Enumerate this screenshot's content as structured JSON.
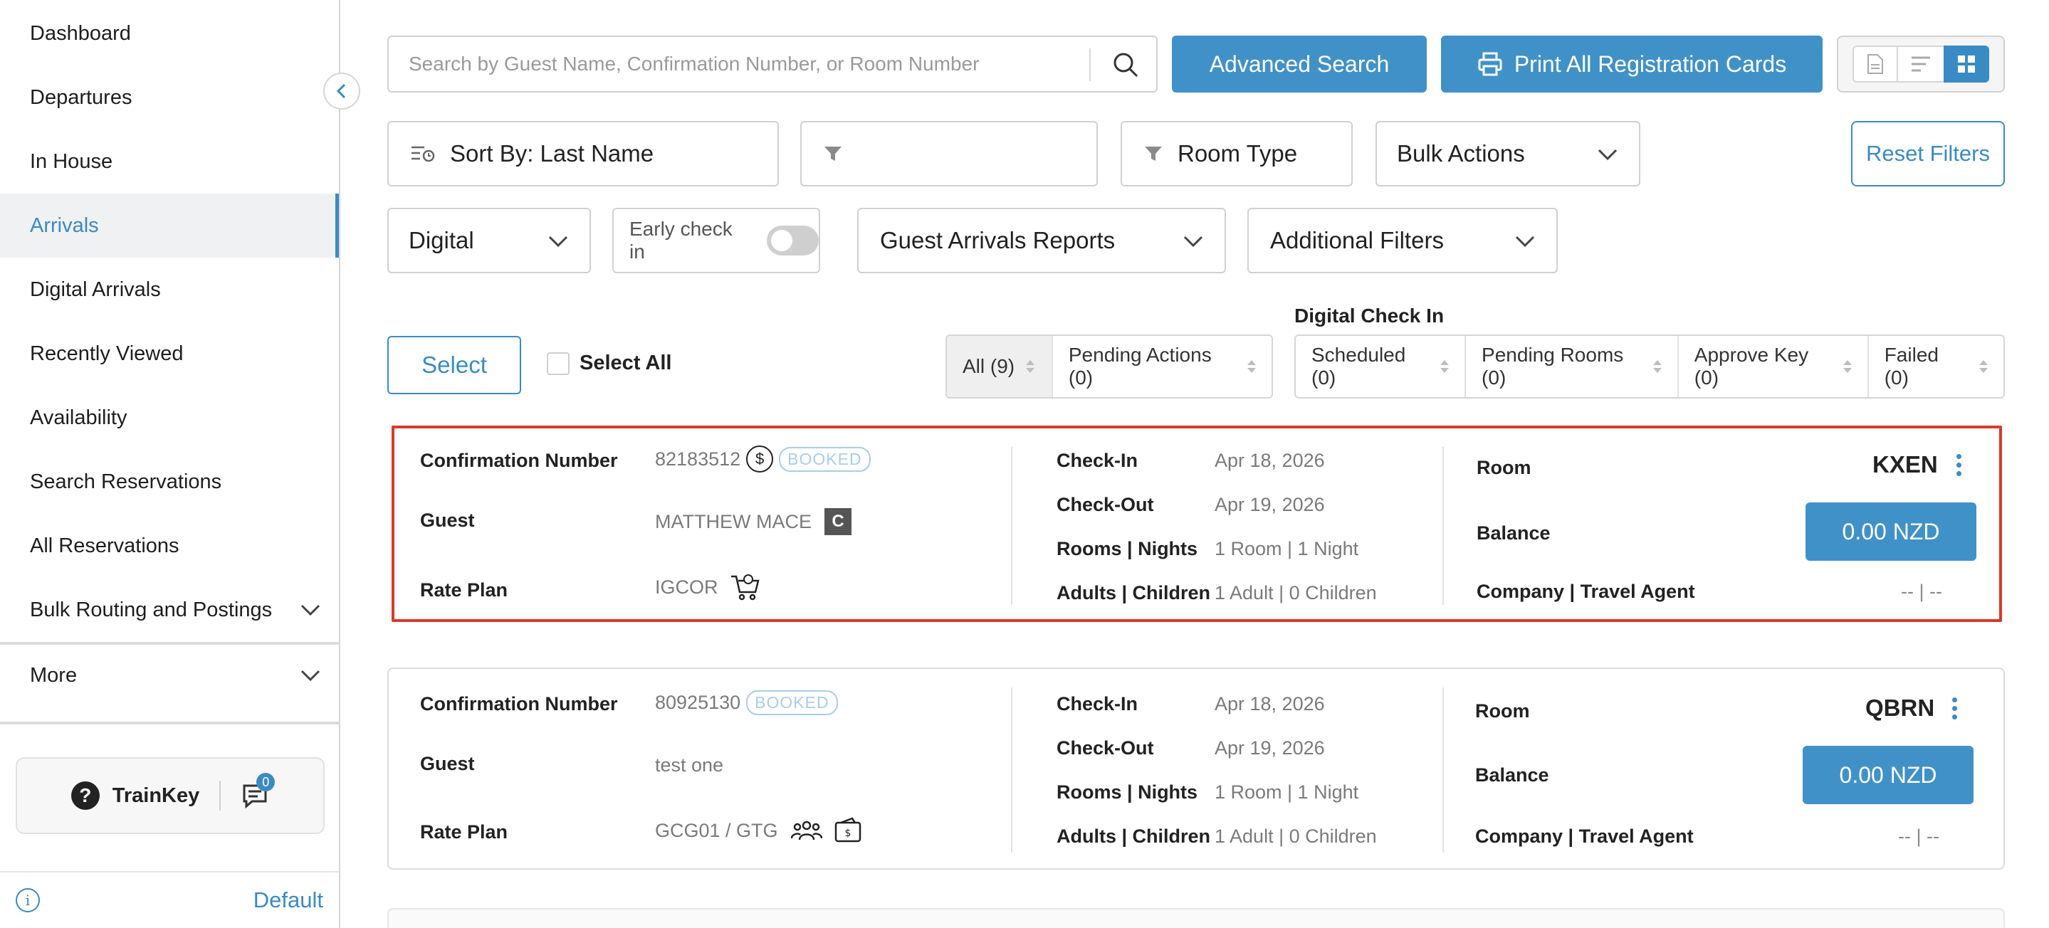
{
  "sidebar": {
    "items": [
      {
        "label": "Dashboard"
      },
      {
        "label": "Departures"
      },
      {
        "label": "In House"
      },
      {
        "label": "Arrivals"
      },
      {
        "label": "Digital Arrivals"
      },
      {
        "label": "Recently Viewed"
      },
      {
        "label": "Availability"
      },
      {
        "label": "Search Reservations"
      },
      {
        "label": "All Reservations"
      },
      {
        "label": "Bulk Routing and Postings"
      },
      {
        "label": "More"
      }
    ],
    "active_item": "Arrivals",
    "trainkey_label": "TrainKey",
    "chat_count": "0",
    "footer_label": "Default"
  },
  "toolbar": {
    "search_placeholder": "Search by Guest Name, Confirmation Number, or Room Number",
    "advanced_search": "Advanced Search",
    "print_cards": "Print All Registration Cards",
    "view_mode_selected": "grid"
  },
  "filters": {
    "sort_by": "Sort By: Last Name",
    "filter_empty": "",
    "room_type": "Room Type",
    "bulk_actions": "Bulk Actions",
    "reset_filters": "Reset Filters",
    "digital": "Digital",
    "early_checkin": "Early check in",
    "early_checkin_on": false,
    "reports": "Guest Arrivals Reports",
    "additional": "Additional Filters"
  },
  "status": {
    "select": "Select",
    "select_all": "Select All",
    "digital_checkin_title": "Digital Check In",
    "tabs": [
      "All (9)",
      "Pending Actions (0)"
    ],
    "digital_tabs": [
      "Scheduled (0)",
      "Pending Rooms (0)",
      "Approve Key (0)",
      "Failed (0)"
    ]
  },
  "labels": {
    "confirmation": "Confirmation Number",
    "guest": "Guest",
    "rate_plan": "Rate Plan",
    "check_in": "Check-In",
    "check_out": "Check-Out",
    "rooms_nights": "Rooms | Nights",
    "adults_children": "Adults | Children",
    "room": "Room",
    "balance": "Balance",
    "company_ta": "Company | Travel Agent"
  },
  "reservations": [
    {
      "confirmation": "82183512",
      "status": "BOOKED",
      "guest": "MATTHEW MACE",
      "guest_badge": "C",
      "rate_plan": "IGCOR",
      "check_in": "Apr 18, 2026",
      "check_out": "Apr 19, 2026",
      "rooms_nights": "1 Room | 1 Night",
      "adults_children": "1 Adult | 0 Children",
      "room": "KXEN",
      "balance": "0.00 NZD",
      "company_ta": "-- | --"
    },
    {
      "confirmation": "80925130",
      "status": "BOOKED",
      "guest": "test one",
      "rate_plan": "GCG01 / GTG",
      "check_in": "Apr 18, 2026",
      "check_out": "Apr 19, 2026",
      "rooms_nights": "1 Room | 1 Night",
      "adults_children": "1 Adult | 0 Children",
      "room": "QBRN",
      "balance": "0.00 NZD",
      "company_ta": "-- | --"
    }
  ],
  "colors": {
    "accent": "#4191c9",
    "highlight_border": "#d83a2a",
    "booked": "#a9cde6"
  }
}
